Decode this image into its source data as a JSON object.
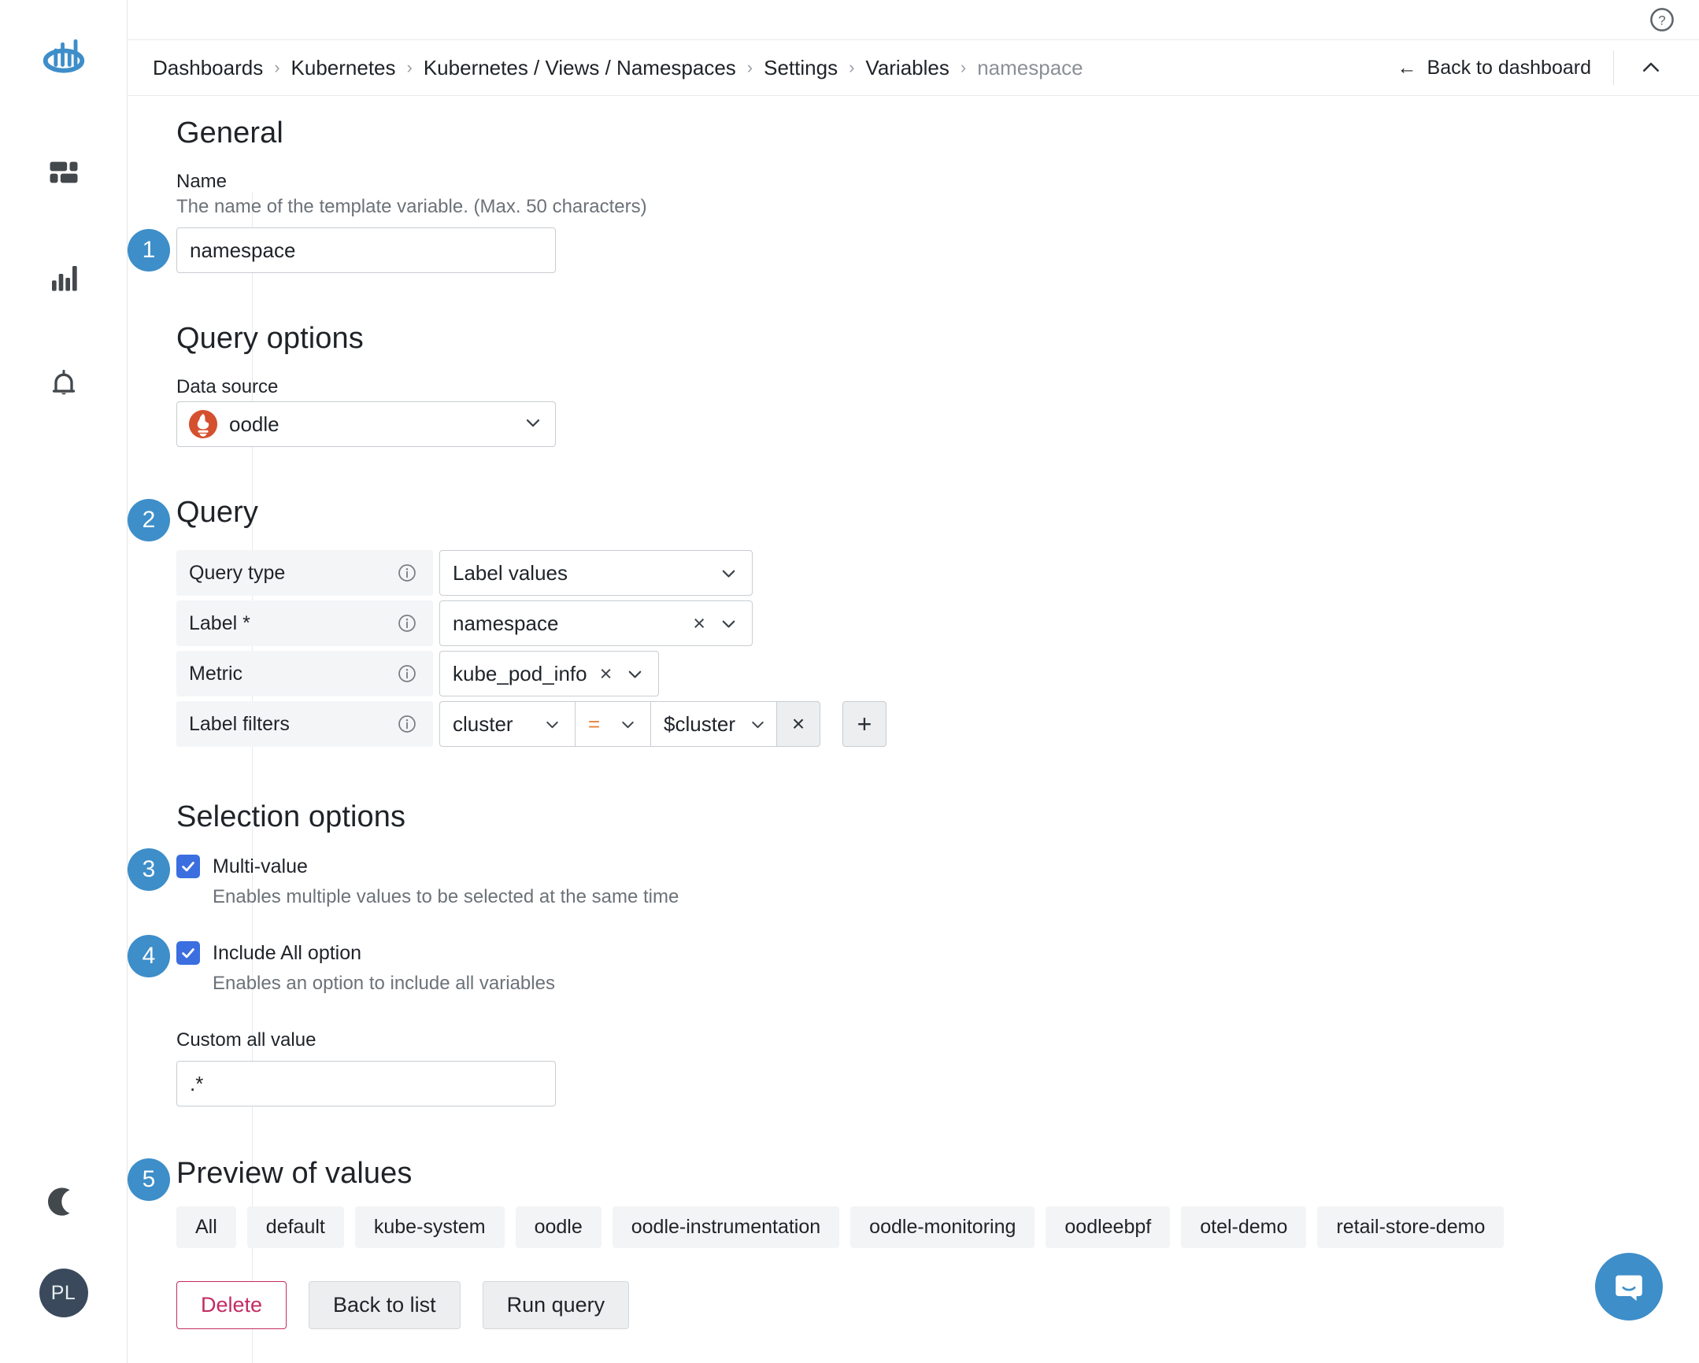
{
  "app": {
    "logo_name": "oodle-logo",
    "avatar_initials": "PL"
  },
  "rail": {
    "items": [
      {
        "name": "dashboards-icon",
        "label": "Dashboards"
      },
      {
        "name": "metrics-icon",
        "label": "Metrics"
      },
      {
        "name": "alerts-icon",
        "label": "Alerts"
      }
    ],
    "theme_toggle_label": "Dark mode"
  },
  "topbar": {
    "help_label": "Help"
  },
  "breadcrumb": {
    "items": [
      {
        "label": "Dashboards",
        "current": false
      },
      {
        "label": "Kubernetes",
        "current": false
      },
      {
        "label": "Kubernetes / Views / Namespaces",
        "current": false
      },
      {
        "label": "Settings",
        "current": false
      },
      {
        "label": "Variables",
        "current": false
      },
      {
        "label": "namespace",
        "current": true
      }
    ],
    "separator": "›",
    "back_to_dashboard": "Back to dashboard",
    "back_arrow": "←",
    "collapse_caret": "⌃"
  },
  "general": {
    "heading": "General",
    "name_label": "Name",
    "name_desc": "The name of the template variable. (Max. 50 characters)",
    "name_value": "namespace",
    "name_placeholder": "",
    "step": "1"
  },
  "query_options": {
    "heading": "Query options",
    "datasource_label": "Data source",
    "datasource_value": "oodle",
    "datasource_icon": "prometheus-flame-icon",
    "caret": "⌄"
  },
  "query": {
    "heading": "Query",
    "step": "2",
    "rows": [
      {
        "label": "Query type",
        "info_icon": "info-icon",
        "control": "select",
        "value": "Label values",
        "clearable": false
      },
      {
        "label": "Label *",
        "info_icon": "info-icon",
        "control": "select",
        "value": "namespace",
        "clearable": true
      },
      {
        "label": "Metric",
        "info_icon": "info-icon",
        "control": "select-compact",
        "value": "kube_pod_info",
        "clearable": true
      }
    ],
    "filters_label": "Label filters",
    "filter": {
      "key": "cluster",
      "operator": "=",
      "value": "$cluster",
      "remove_label": "×"
    },
    "add_filter_label": "+"
  },
  "selection_options": {
    "heading": "Selection options",
    "multi_value": {
      "step": "3",
      "label": "Multi-value",
      "desc": "Enables multiple values to be selected at the same time",
      "checked": true
    },
    "include_all": {
      "step": "4",
      "label": "Include All option",
      "desc": "Enables an option to include all variables",
      "checked": true
    },
    "custom_all": {
      "label": "Custom all value",
      "value": ".*",
      "placeholder": ""
    }
  },
  "preview": {
    "step": "5",
    "heading": "Preview of values",
    "values": [
      "All",
      "default",
      "kube-system",
      "oodle",
      "oodle-instrumentation",
      "oodle-monitoring",
      "oodleebpf",
      "otel-demo",
      "retail-store-demo"
    ]
  },
  "actions": {
    "delete": "Delete",
    "back_to_list": "Back to list",
    "run_query": "Run query"
  },
  "chat": {
    "icon": "chat-bubble-icon"
  },
  "colors": {
    "accent_blue": "#3d8ec9",
    "checkbox_blue": "#3b6fe0",
    "danger": "#c42b63",
    "operator_orange": "#e8803a",
    "datasource_orange": "#d4502f",
    "avatar_bg": "#3a4a5c"
  }
}
